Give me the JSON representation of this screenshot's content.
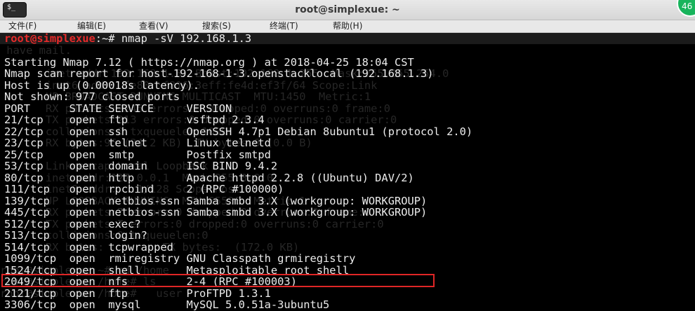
{
  "window": {
    "title": "root@simplexue: ~",
    "app_icon": "terminal-icon",
    "app_icon_glyph": "$_",
    "badge": "46",
    "accent_color": "#18b45c"
  },
  "menu": {
    "items": [
      "文件(F)",
      "编辑(E)",
      "查看(V)",
      "搜索(S)",
      "终端(T)",
      "帮助(H)"
    ]
  },
  "terminal": {
    "prompt": {
      "user_host": "root@simplexue",
      "path_symbol": ":~# ",
      "command": "nmap -sV 192.168.1.3"
    },
    "header_lines": [
      "Starting Nmap 7.12 ( https://nmap.org ) at 2018-04-25 18:04 CST",
      "Nmap scan report for host-192-168-1-3.openstacklocal (192.168.1.3)",
      "Host is up (0.00018s latency).",
      "Not shown: 977 closed ports"
    ],
    "table_header": "PORT      STATE SERVICE     VERSION",
    "rows": [
      "21/tcp    open  ftp         vsftpd 2.3.4",
      "22/tcp    open  ssh         OpenSSH 4.7p1 Debian 8ubuntu1 (protocol 2.0)",
      "23/tcp    open  telnet      Linux telnetd",
      "25/tcp    open  smtp        Postfix smtpd",
      "53/tcp    open  domain      ISC BIND 9.4.2",
      "80/tcp    open  http        Apache httpd 2.2.8 ((Ubuntu) DAV/2)",
      "111/tcp   open  rpcbind     2 (RPC #100000)",
      "139/tcp   open  netbios-ssn Samba smbd 3.X (workgroup: WORKGROUP)",
      "445/tcp   open  netbios-ssn Samba smbd 3.X (workgroup: WORKGROUP)",
      "512/tcp   open  exec?",
      "513/tcp   open  login?",
      "514/tcp   open  tcpwrapped",
      "1099/tcp  open  rmiregistry GNU Classpath grmiregistry",
      "1524/tcp  open  shell       Metasploitable root shell",
      "2049/tcp  open  nfs         2-4 (RPC #100003)",
      "2121/tcp  open  ftp         ProFTPD 1.3.1",
      "3306/tcp  open  mysql       MySQL 5.0.51a-3ubuntu5"
    ],
    "ghost_lines": [
      " have mail.",
      "",
      "       inet addr:192.168.1.3  Bcast:192.168.1.255  Mask:255.255.254.0",
      "       inet6 addr: fe80::f816:3eff:fe4d:ef3f/64 Scope:Link",
      "       UP BROADCAST RUNNING MULTICAST  MTU:1450  Metric:1",
      "       RX packets:2245 errors:0 dropped:0 overruns:0 frame:0",
      "       TX packets:213 errors:0 dropped:0 overruns:0 carrier:0",
      "       collisions:0 txqueuelen:1000",
      "       RX bytes:96 (24.2 KB)  TX bytes:6 (0.0 B)",
      "",
      "       Link encap:Local Loopback",
      "       inet addr:127.0.0.1  Mask:255.0.0.0",
      "       inet6 addr: ::1/128 Scope:Host",
      "       UP LOOPBACK RUNNING  MTU:65536  Metric:1",
      "       RX packets:7 errors:0 dropped:0 overruns:0 frame:0",
      "       TX packets:7 errors:0 dropped:0 overruns:0 carrier:0",
      "       collisions:0 txqueuelen:0",
      "       RX bytes:         TX bytes:  (172.0 KB)",
      "",
      "root@simplexue:~# cd /home",
      "root@simplexue:/home# ls",
      "root@simplexue:/home#   user"
    ],
    "highlighted_row_index": 14,
    "highlight_color": "#e02626",
    "prompt_color": "#e52a2a"
  }
}
